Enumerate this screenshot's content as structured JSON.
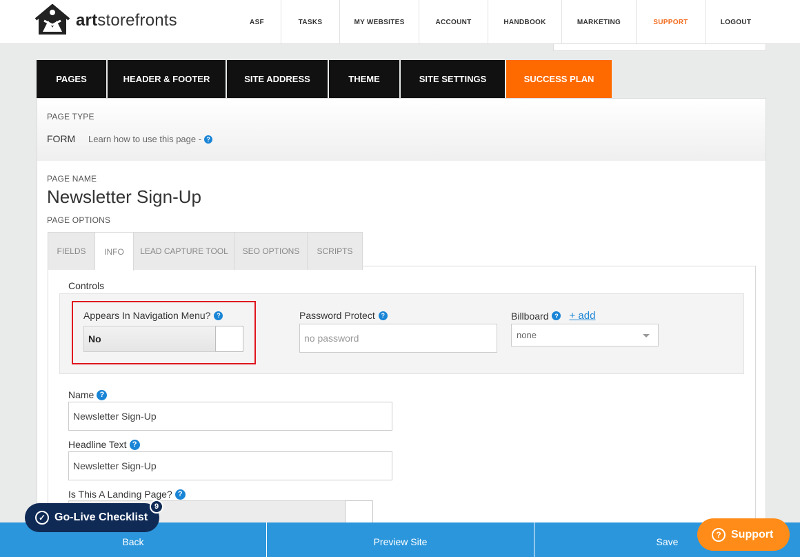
{
  "header": {
    "logo_text": "artstorefronts",
    "nav": [
      "ASF",
      "TASKS",
      "MY WEBSITES",
      "ACCOUNT",
      "HANDBOOK",
      "MARKETING",
      "SUPPORT",
      "LOGOUT"
    ],
    "active_nav": "SUPPORT",
    "active_color": "#f26b1d"
  },
  "section_tabs": [
    "PAGES",
    "HEADER & FOOTER",
    "SITE ADDRESS",
    "THEME",
    "SITE SETTINGS",
    "SUCCESS PLAN"
  ],
  "page_type": {
    "label": "PAGE TYPE",
    "value": "FORM",
    "help_text": "Learn how to use this page -"
  },
  "page": {
    "name_label": "PAGE NAME",
    "name": "Newsletter Sign-Up",
    "options_label": "PAGE OPTIONS"
  },
  "option_tabs": [
    "FIELDS",
    "INFO",
    "LEAD CAPTURE TOOL",
    "SEO OPTIONS",
    "SCRIPTS"
  ],
  "active_option_tab": "INFO",
  "controls": {
    "title": "Controls",
    "nav_menu_label": "Appears In Navigation Menu?",
    "nav_menu_value": "No",
    "password_label": "Password Protect",
    "password_placeholder": "no password",
    "billboard_label": "Billboard",
    "billboard_add": "+ add",
    "billboard_value": "none"
  },
  "fields": {
    "name_label": "Name",
    "name_value": "Newsletter Sign-Up",
    "headline_label": "Headline Text",
    "headline_value": "Newsletter Sign-Up",
    "landing_label": "Is This A Landing Page?"
  },
  "bottom_bar": {
    "back": "Back",
    "preview": "Preview Site",
    "save": "Save",
    "color": "#2b96dc"
  },
  "checklist": {
    "label": "Go-Live Checklist",
    "count": "9"
  },
  "support": {
    "label": "Support",
    "color": "#ff8c18"
  },
  "colors": {
    "accent_orange": "#ff6a00",
    "help_blue": "#1a85d6",
    "highlight_red": "#e0141e"
  }
}
